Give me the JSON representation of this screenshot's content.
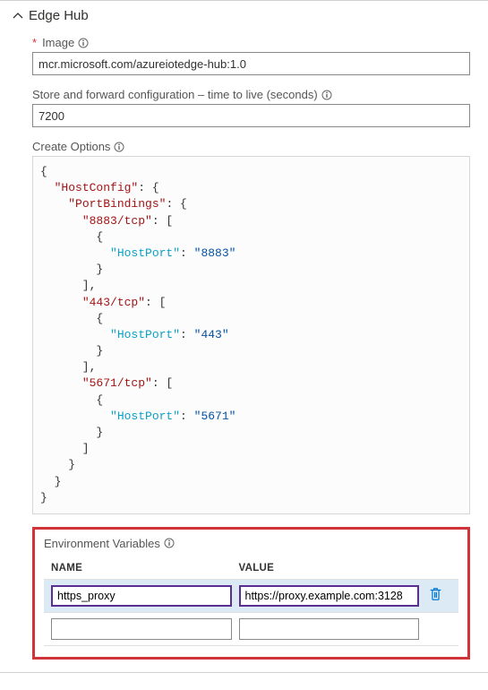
{
  "header": {
    "title": "Edge Hub"
  },
  "image": {
    "label": "Image",
    "required": "*",
    "value": "mcr.microsoft.com/azureiotedge-hub:1.0"
  },
  "ttl": {
    "label": "Store and forward configuration – time to live (seconds)",
    "value": "7200"
  },
  "create_options": {
    "label": "Create Options",
    "json": {
      "HostConfig": {
        "PortBindings": {
          "8883/tcp": [
            {
              "HostPort": "8883"
            }
          ],
          "443/tcp": [
            {
              "HostPort": "443"
            }
          ],
          "5671/tcp": [
            {
              "HostPort": "5671"
            }
          ]
        }
      }
    }
  },
  "env": {
    "label": "Environment Variables",
    "columns": {
      "name": "NAME",
      "value": "VALUE"
    },
    "rows": [
      {
        "name": "https_proxy",
        "value": "https://proxy.example.com:3128",
        "active": true
      },
      {
        "name": "",
        "value": "",
        "active": false
      }
    ]
  },
  "colors": {
    "required": "#d13438",
    "highlight": "#d13438",
    "row_active": "#dceaf6",
    "focus_border": "#5b2e91",
    "icon_blue": "#0078d4"
  }
}
